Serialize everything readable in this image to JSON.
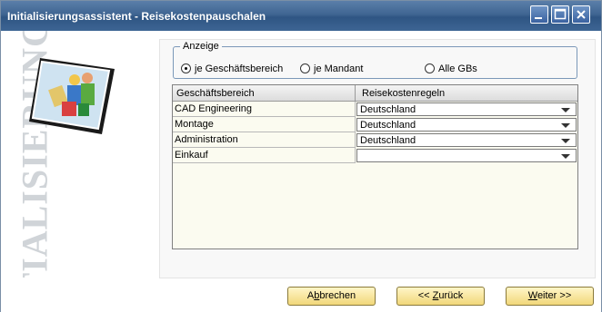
{
  "window": {
    "title": "Initialisierungsassistent - Reisekostenpauschalen"
  },
  "left_panel": {
    "watermark": "TIALISIERUNG"
  },
  "anzeige": {
    "legend": "Anzeige",
    "options": [
      {
        "label": "je Geschäftsbereich",
        "selected": true
      },
      {
        "label": "je Mandant",
        "selected": false
      },
      {
        "label": "Alle GBs",
        "selected": false
      }
    ]
  },
  "grid": {
    "headers": [
      "Geschäftsbereich",
      "Reisekostenregeln"
    ],
    "rows": [
      {
        "area": "CAD Engineering",
        "rule": "Deutschland"
      },
      {
        "area": "Montage",
        "rule": "Deutschland"
      },
      {
        "area": "Administration",
        "rule": "Deutschland"
      },
      {
        "area": "Einkauf",
        "rule": ""
      }
    ]
  },
  "buttons": {
    "cancel_pre": "A",
    "cancel_key": "b",
    "cancel_post": "brechen",
    "back_pre": "<< ",
    "back_key": "Z",
    "back_post": "urück",
    "next_pre": "",
    "next_key": "W",
    "next_post": "eiter >>"
  },
  "colors": {
    "titlebar": "#3f6592",
    "button": "#f1d77a",
    "grid_bg": "#fbfbf0"
  }
}
